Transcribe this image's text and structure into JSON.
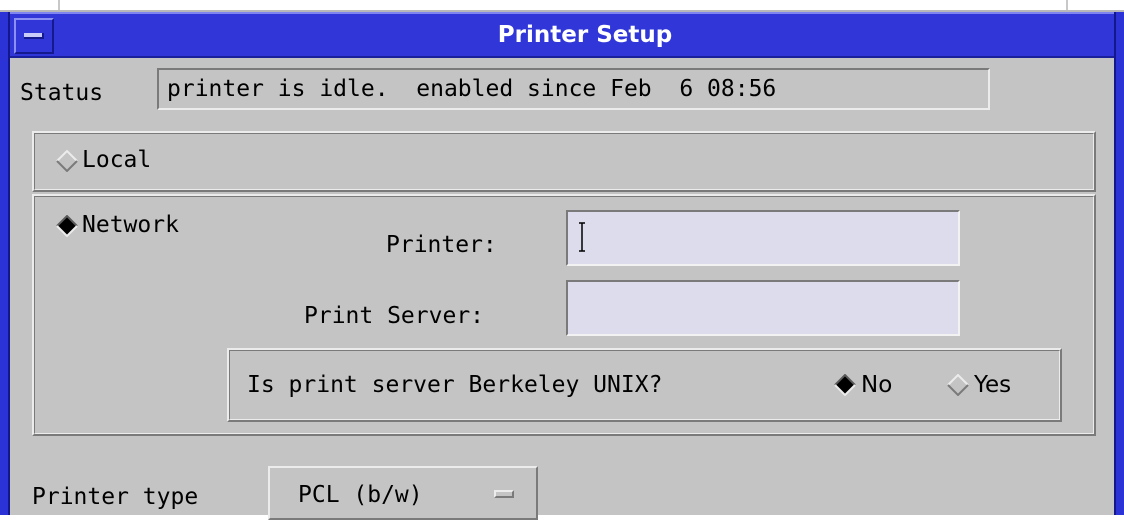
{
  "window": {
    "title": "Printer Setup"
  },
  "status": {
    "label": "Status",
    "value": "printer is idle.  enabled since Feb  6 08:56"
  },
  "connection": {
    "local_label": "Local",
    "network_label": "Network",
    "selected": "Network"
  },
  "network": {
    "printer_label": "Printer:",
    "printer_value": "",
    "print_server_label": "Print Server:",
    "print_server_value": "",
    "berkeley_question": "Is print server Berkeley UNIX?",
    "no_label": "No",
    "yes_label": "Yes",
    "berkeley_selected": "No"
  },
  "printer_type": {
    "label": "Printer type",
    "value": "PCL (b/w)"
  },
  "colors": {
    "titlebar": "#3036d8",
    "background": "#c4c4c4",
    "field": "#dcdcec"
  }
}
